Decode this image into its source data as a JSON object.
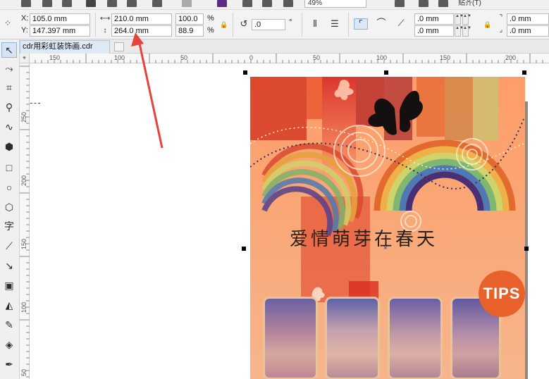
{
  "toolbar_top": {
    "zoom_value": "49%",
    "snap_label": "贴齐(T)"
  },
  "property_bar": {
    "x_label": "X:",
    "x_value": "105.0 mm",
    "y_label": "Y:",
    "y_value": "147.397 mm",
    "width_value": "210.0 mm",
    "height_value": "264.0 mm",
    "scale_x": "100.0",
    "scale_y": "88.9",
    "percent_sign": "%",
    "rotation_value": ".0",
    "degree_sign": "°",
    "corner_tl": ".0 mm",
    "corner_bl": ".0 mm",
    "corner_tr": ".0 mm",
    "corner_br": ".0 mm"
  },
  "document": {
    "tab_label": "cdr用彩虹装饰画.cdr"
  },
  "ruler": {
    "top_ticks": [
      "150",
      "100",
      "50",
      "0",
      "50",
      "100",
      "150",
      "200"
    ],
    "left_ticks": [
      "250",
      "200",
      "150",
      "100",
      "50"
    ]
  },
  "poster": {
    "title": "爱情萌芽在春天",
    "badge": "TIPS"
  },
  "colors": {
    "annotation_arrow": "#e8423f",
    "poster_orange": "#ff9d68",
    "tips_orange": "#e8602a"
  },
  "icons": {
    "tools": [
      "pick-tool-icon",
      "shape-tool-icon",
      "crop-tool-icon",
      "zoom-tool-icon",
      "freehand-tool-icon",
      "smart-fill-icon",
      "rectangle-tool-icon",
      "ellipse-tool-icon",
      "polygon-tool-icon",
      "text-tool-icon",
      "parallel-dimension-icon",
      "connector-tool-icon",
      "drop-shadow-icon",
      "transparency-icon",
      "eyedropper-icon",
      "interactive-fill-icon",
      "smart-fill-pen-icon"
    ]
  }
}
